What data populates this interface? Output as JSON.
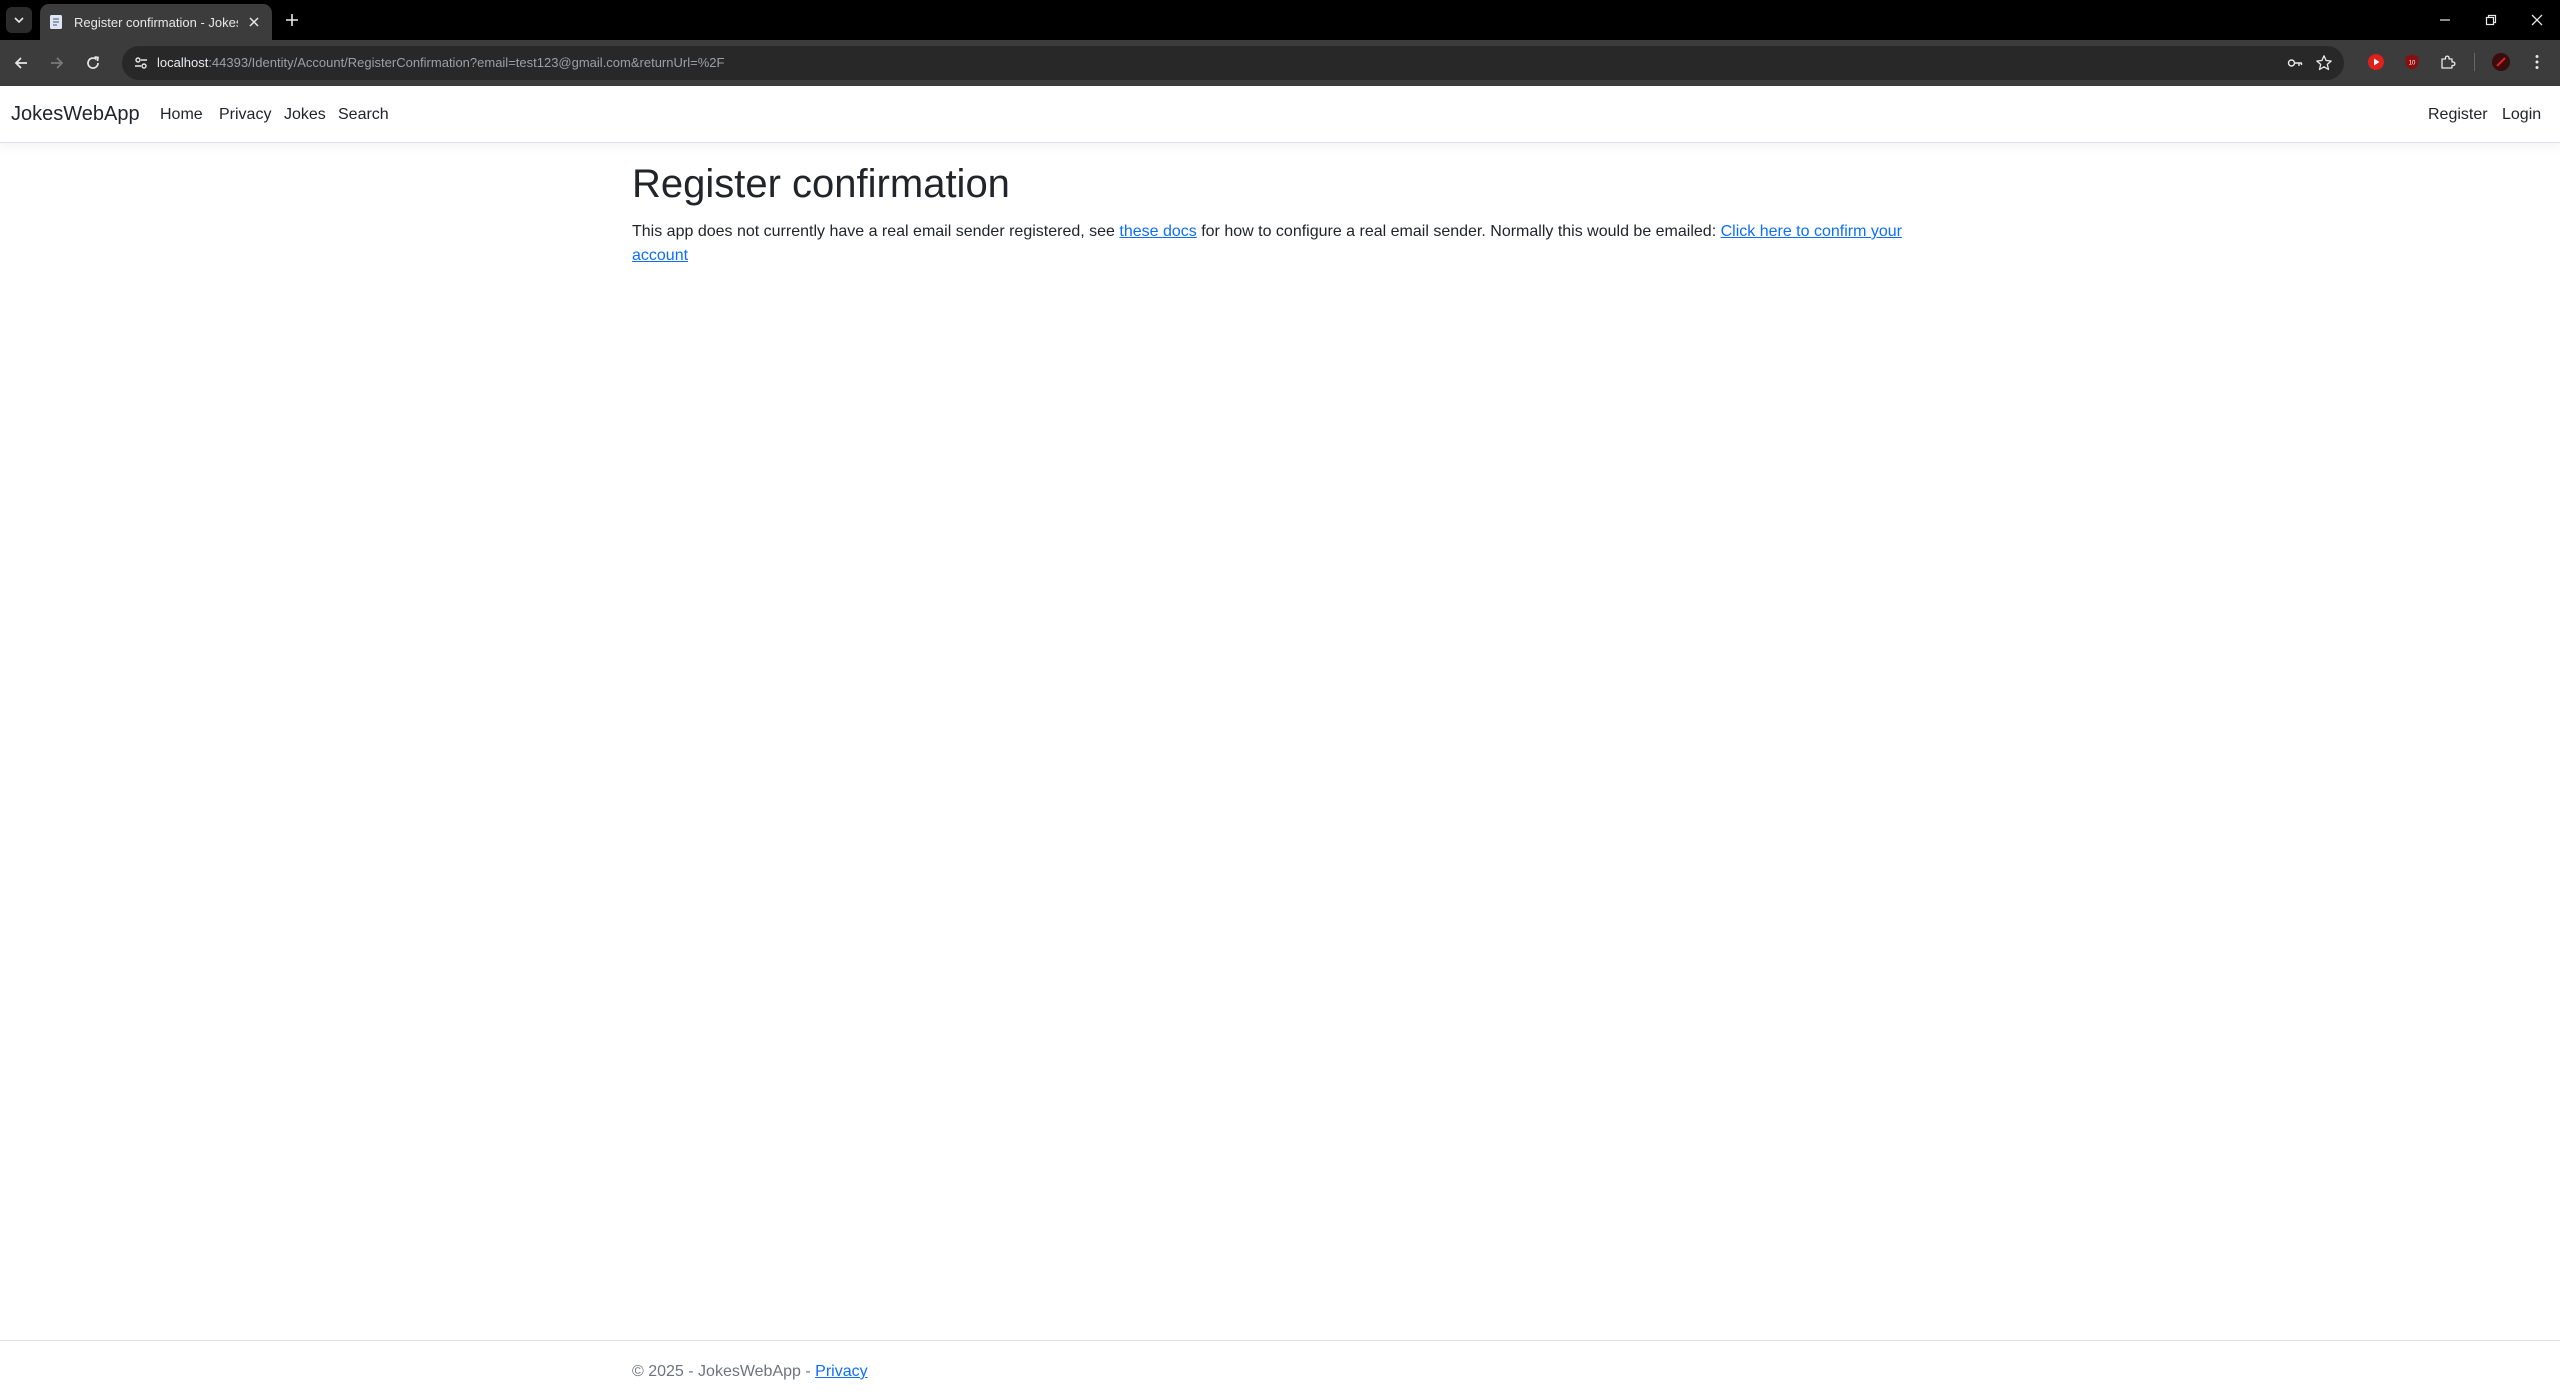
{
  "browser": {
    "tab_title": "Register confirmation - JokesWebApp",
    "url_host": "localhost",
    "url_rest": ":44393/Identity/Account/RegisterConfirmation?email=test123@gmail.com&returnUrl=%2F"
  },
  "site": {
    "brand": "JokesWebApp",
    "nav": {
      "home": "Home",
      "privacy": "Privacy",
      "jokes": "Jokes",
      "search": "Search",
      "register": "Register",
      "login": "Login"
    }
  },
  "page": {
    "title": "Register confirmation",
    "text_before_docs": "This app does not currently have a real email sender registered, see ",
    "docs_link": "these docs",
    "text_after_docs": " for how to configure a real email sender. Normally this would be emailed: ",
    "confirm_link": "Click here to confirm your account"
  },
  "footer": {
    "copyright": "© 2025 - JokesWebApp - ",
    "privacy_link": "Privacy"
  },
  "colors": {
    "link": "#0d6efd",
    "text": "#212529",
    "muted": "#6c757d",
    "chrome_dark": "#3c3c3c"
  }
}
